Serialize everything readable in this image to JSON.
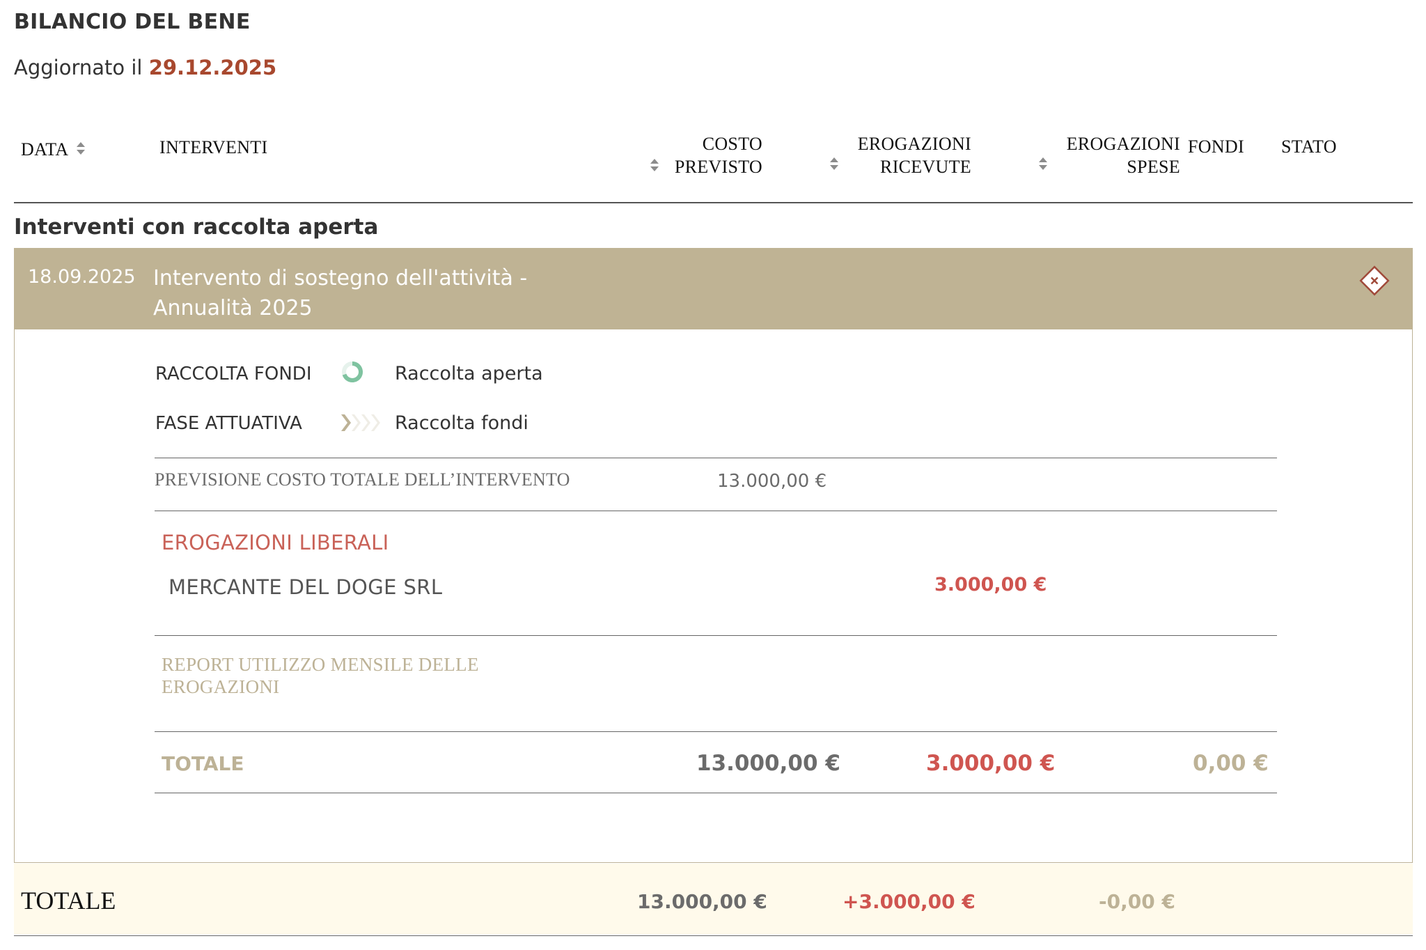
{
  "page": {
    "title": "BILANCIO DEL BENE",
    "updated_prefix": "Aggiornato il",
    "updated_date": "29.12.2025"
  },
  "table_header": {
    "data": "DATA",
    "interventi": "INTERVENTI",
    "costo_line1": "COSTO",
    "costo_line2": "PREVISTO",
    "erog_ric_line1": "EROGAZIONI",
    "erog_ric_line2": "RICEVUTE",
    "erog_spese_line1": "EROGAZIONI",
    "erog_spese_line2": "SPESE",
    "fondi": "FONDI",
    "stato": "STATO"
  },
  "section": {
    "title": "Interventi con raccolta aperta"
  },
  "intervento": {
    "date": "18.09.2025",
    "title": "Intervento di sostegno dell'attività - Annualità 2025",
    "raccolta_label": "RACCOLTA FONDI",
    "raccolta_value": "Raccolta aperta",
    "fase_label": "FASE ATTUATIVA",
    "fase_value": "Raccolta fondi",
    "previsione_label": "PREVISIONE COSTO TOTALE DELL’INTERVENTO",
    "previsione_value": "13.000,00 €",
    "erogazioni_title": "EROGAZIONI LIBERALI",
    "erogazioni": [
      {
        "donor": "MERCANTE DEL DOGE SRL",
        "amount": "3.000,00 €"
      }
    ],
    "report_title": "REPORT UTILIZZO MENSILE DELLE EROGAZIONI",
    "totale_label": "TOTALE",
    "totale_costo": "13.000,00 €",
    "totale_erogazioni": "3.000,00 €",
    "totale_spese": "0,00 €"
  },
  "footer": {
    "label": "TOTALE",
    "costo": "13.000,00 €",
    "erogazioni": "+3.000,00 €",
    "spese": "-0,00 €"
  },
  "colors": {
    "accent_date": "#a8482e",
    "header_band": "#bfb394",
    "gold_text": "#bdb296",
    "red_text": "#cf5550",
    "footer_bg": "#fffaeb"
  },
  "icons": {
    "sort": "sort-arrows-icon",
    "close": "close-diamond-icon",
    "raccolta": "progress-ring-icon",
    "fase": "chevron-steps-icon"
  }
}
